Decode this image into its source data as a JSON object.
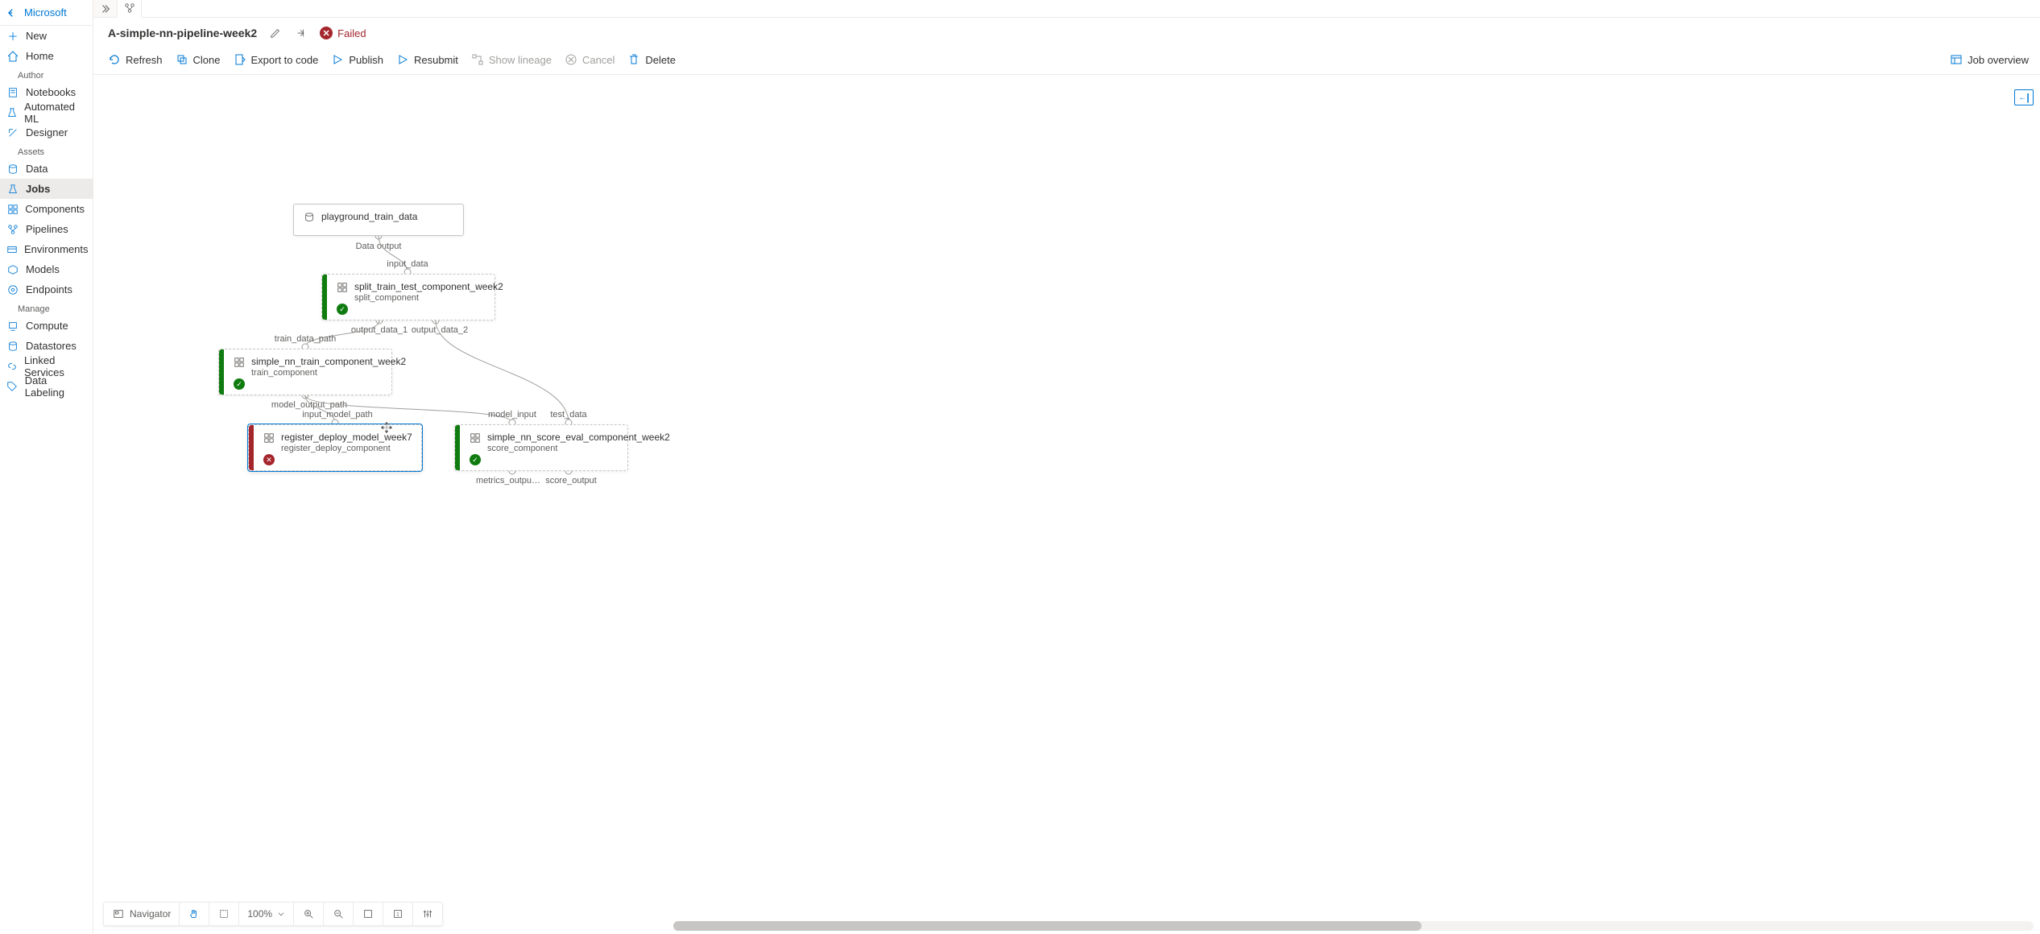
{
  "brand": "Microsoft",
  "sidebar": {
    "new": "New",
    "home": "Home",
    "sections": {
      "author": "Author",
      "assets": "Assets",
      "manage": "Manage"
    },
    "author_items": [
      "Notebooks",
      "Automated ML",
      "Designer"
    ],
    "asset_items": [
      "Data",
      "Jobs",
      "Components",
      "Pipelines",
      "Environments",
      "Models",
      "Endpoints"
    ],
    "manage_items": [
      "Compute",
      "Datastores",
      "Linked Services",
      "Data Labeling"
    ]
  },
  "header": {
    "pipeline_name": "A-simple-nn-pipeline-week2",
    "status_label": "Failed"
  },
  "toolbar": {
    "refresh": "Refresh",
    "clone": "Clone",
    "export": "Export to code",
    "publish": "Publish",
    "resubmit": "Resubmit",
    "lineage": "Show lineage",
    "cancel": "Cancel",
    "delete": "Delete",
    "joboverview": "Job overview"
  },
  "nodes": {
    "n0": {
      "title": "playground_train_data"
    },
    "n1": {
      "title": "split_train_test_component_week2",
      "sub": "split_component"
    },
    "n2": {
      "title": "simple_nn_train_component_week2",
      "sub": "train_component"
    },
    "n3": {
      "title": "register_deploy_model_week7",
      "sub": "register_deploy_component"
    },
    "n4": {
      "title": "simple_nn_score_eval_component_week2",
      "sub": "score_component"
    }
  },
  "ports": {
    "p_data_output": "Data output",
    "p_input_data": "input_data",
    "p_output_data_1": "output_data_1",
    "p_output_data_2": "output_data_2",
    "p_train_data_path": "train_data_path",
    "p_model_output_path": "model_output_path",
    "p_input_model_path": "input_model_path",
    "p_model_input": "model_input",
    "p_test_data": "test_data",
    "p_metrics_output": "metrics_outpu…",
    "p_score_output": "score_output"
  },
  "navigator": {
    "label": "Navigator",
    "zoom": "100%"
  }
}
